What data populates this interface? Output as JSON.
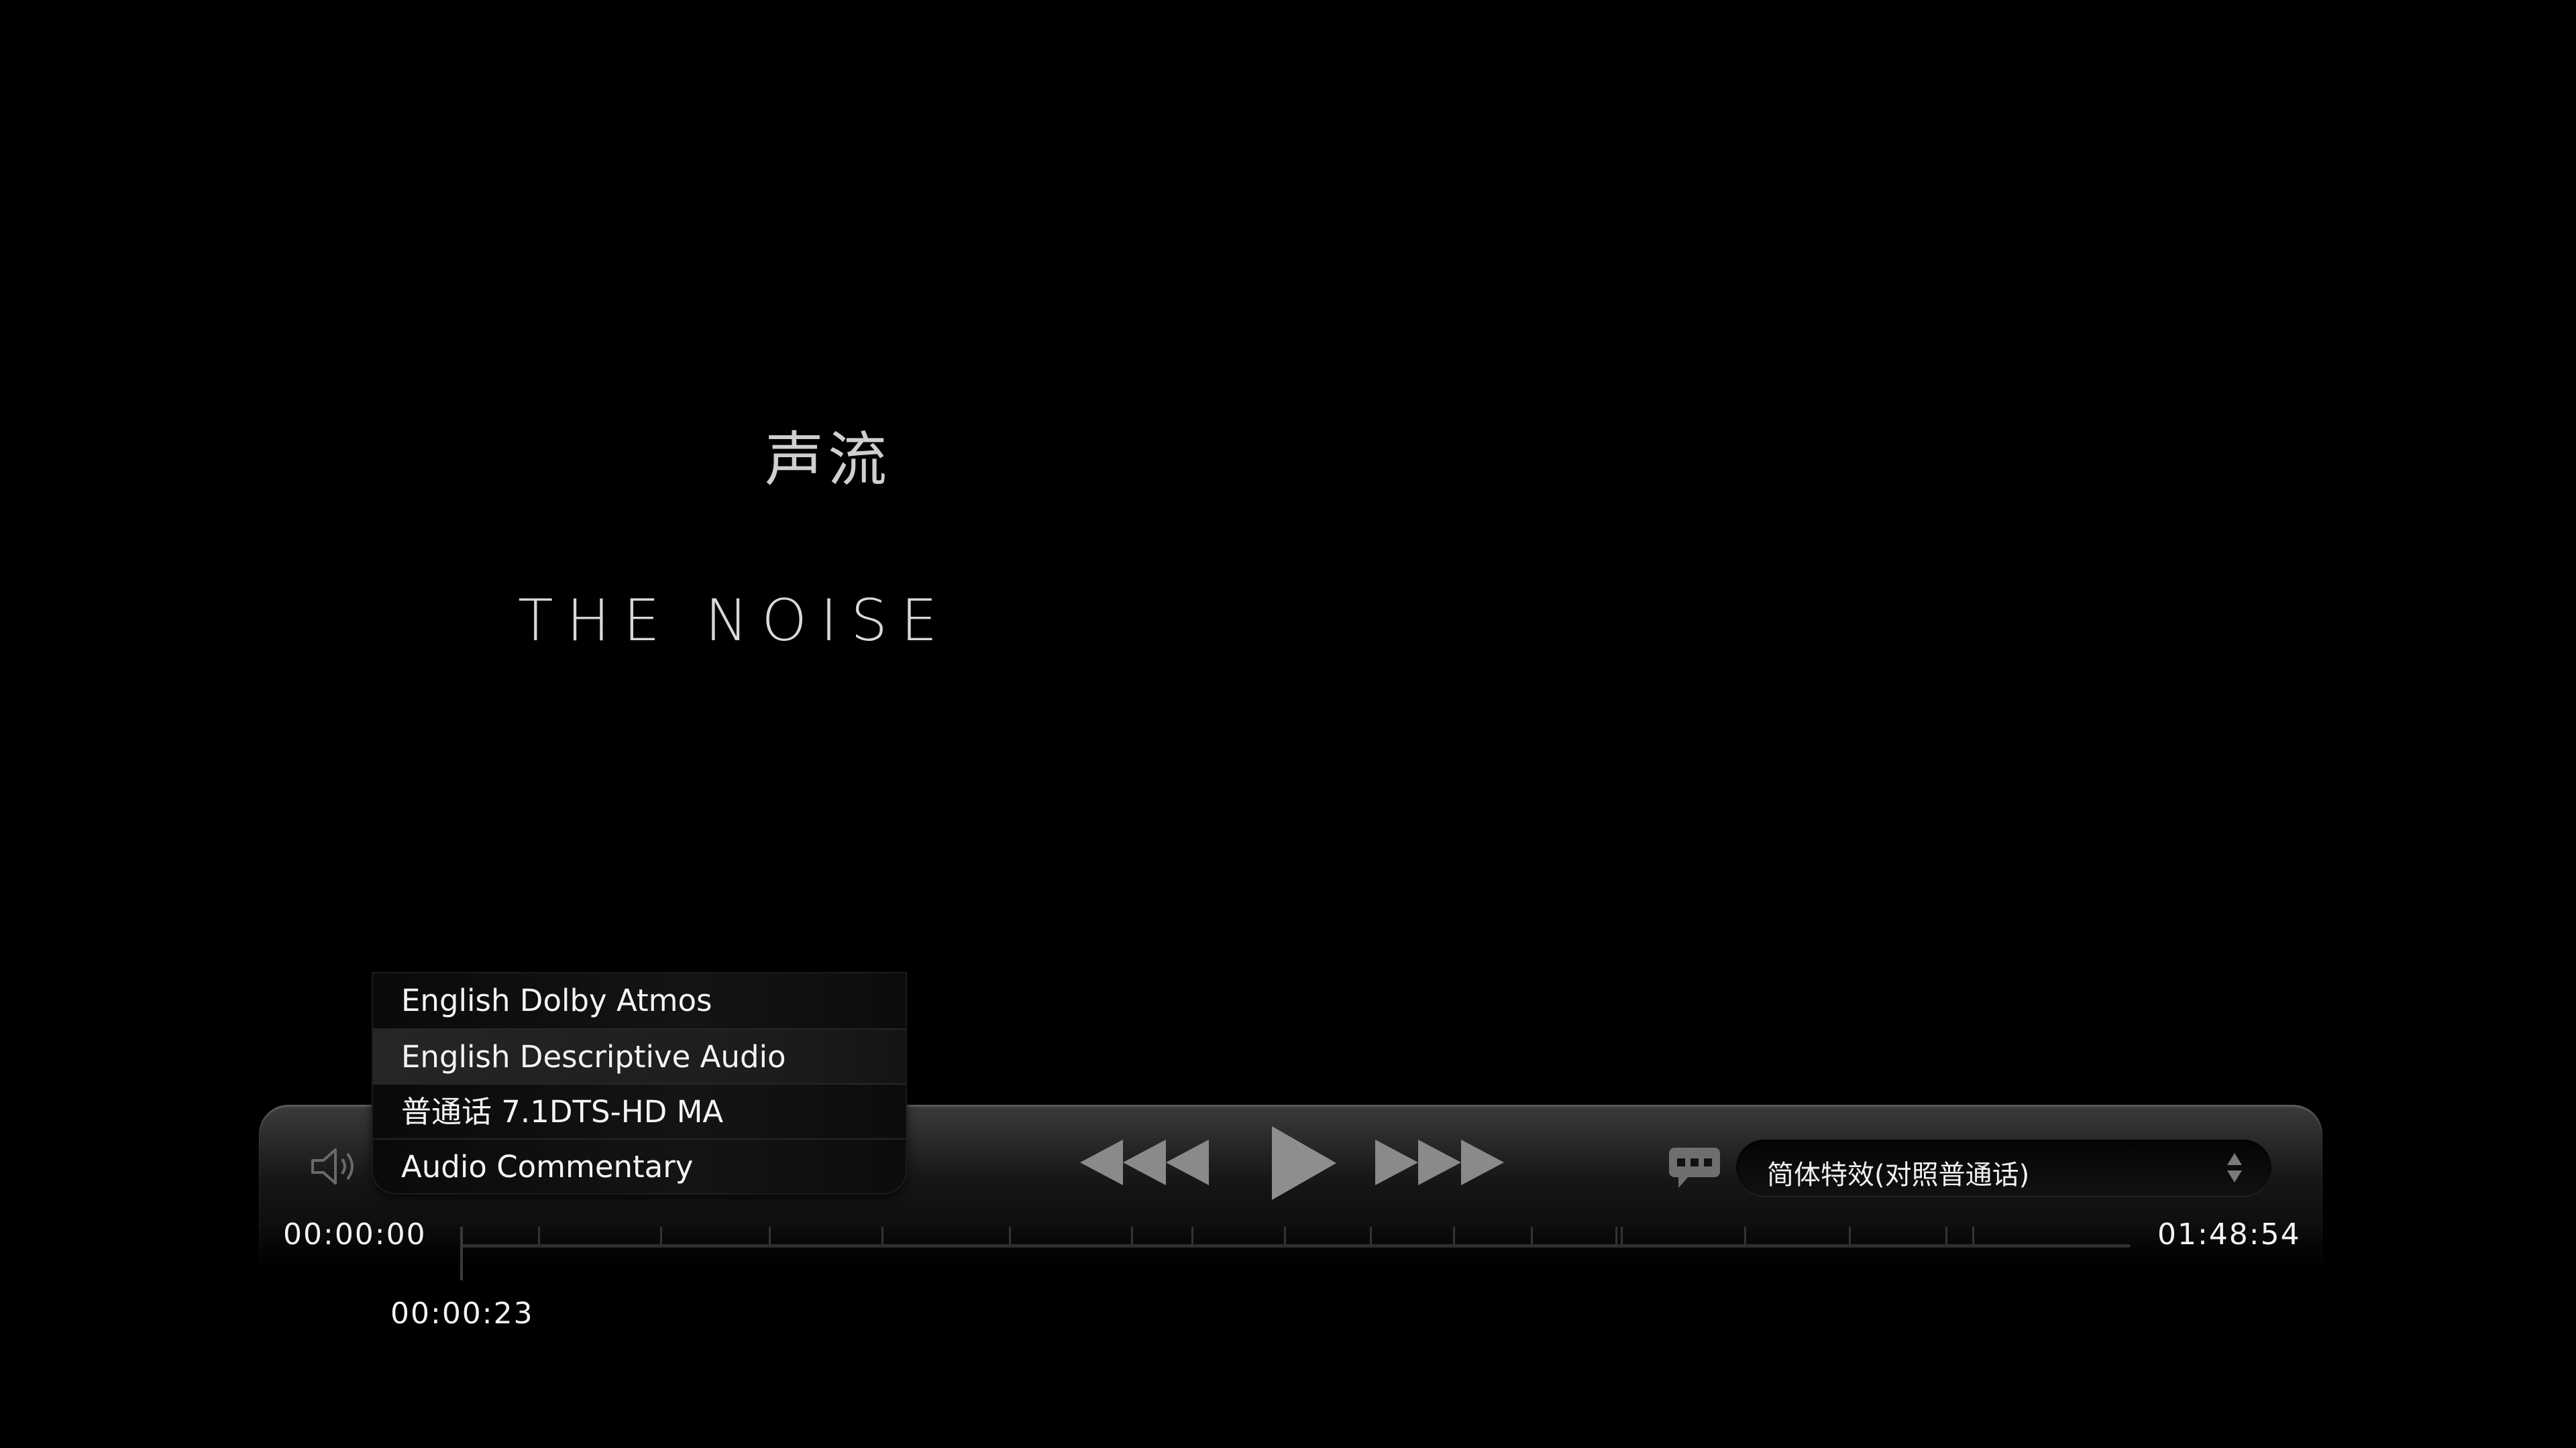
{
  "title": {
    "chinese": "声流",
    "english": "THE NOISE"
  },
  "audio_menu": {
    "items": [
      {
        "label": "English Dolby Atmos"
      },
      {
        "label": "English Descriptive Audio",
        "selected": true
      },
      {
        "label": "普通话 7.1DTS-HD MA"
      },
      {
        "label": "Audio Commentary"
      }
    ]
  },
  "player": {
    "icons": {
      "volume": "speaker-icon",
      "rewind": "rewind-icon",
      "play": "play-icon",
      "fast_forward": "fast-forward-icon",
      "subtitles": "subtitle-icon"
    },
    "subtitle_selection": "简体特效(对照普通话)",
    "time_current": "00:00:00",
    "time_total": "01:48:54",
    "time_hover": "00:00:23"
  },
  "colors": {
    "background": "#000000",
    "text": "#f2f2f2",
    "control_icons": "#8a8a8a"
  }
}
